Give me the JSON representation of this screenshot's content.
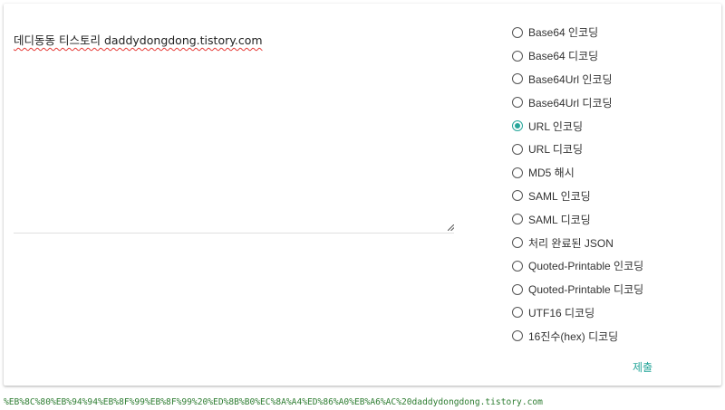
{
  "input": {
    "text": "데디동동 티스토리 daddydongdong.tistory.com"
  },
  "options": [
    {
      "label": "Base64 인코딩",
      "checked": false
    },
    {
      "label": "Base64 디코딩",
      "checked": false
    },
    {
      "label": "Base64Url 인코딩",
      "checked": false
    },
    {
      "label": "Base64Url 디코딩",
      "checked": false
    },
    {
      "label": "URL 인코딩",
      "checked": true
    },
    {
      "label": "URL 디코딩",
      "checked": false
    },
    {
      "label": "MD5 해시",
      "checked": false
    },
    {
      "label": "SAML 인코딩",
      "checked": false
    },
    {
      "label": "SAML 디코딩",
      "checked": false
    },
    {
      "label": "처리 완료된 JSON",
      "checked": false
    },
    {
      "label": "Quoted-Printable 인코딩",
      "checked": false
    },
    {
      "label": "Quoted-Printable 디코딩",
      "checked": false
    },
    {
      "label": "UTF16 디코딩",
      "checked": false
    },
    {
      "label": "16진수(hex) 디코딩",
      "checked": false
    }
  ],
  "submit_label": "제출",
  "result_text": "%EB%8C%80%EB%94%94%EB%8F%99%EB%8F%99%20%ED%8B%B0%EC%8A%A4%ED%86%A0%EB%A6%AC%20daddydongdong.tistory.com",
  "colors": {
    "accent": "#26a69a",
    "result": "#2e7d32"
  }
}
